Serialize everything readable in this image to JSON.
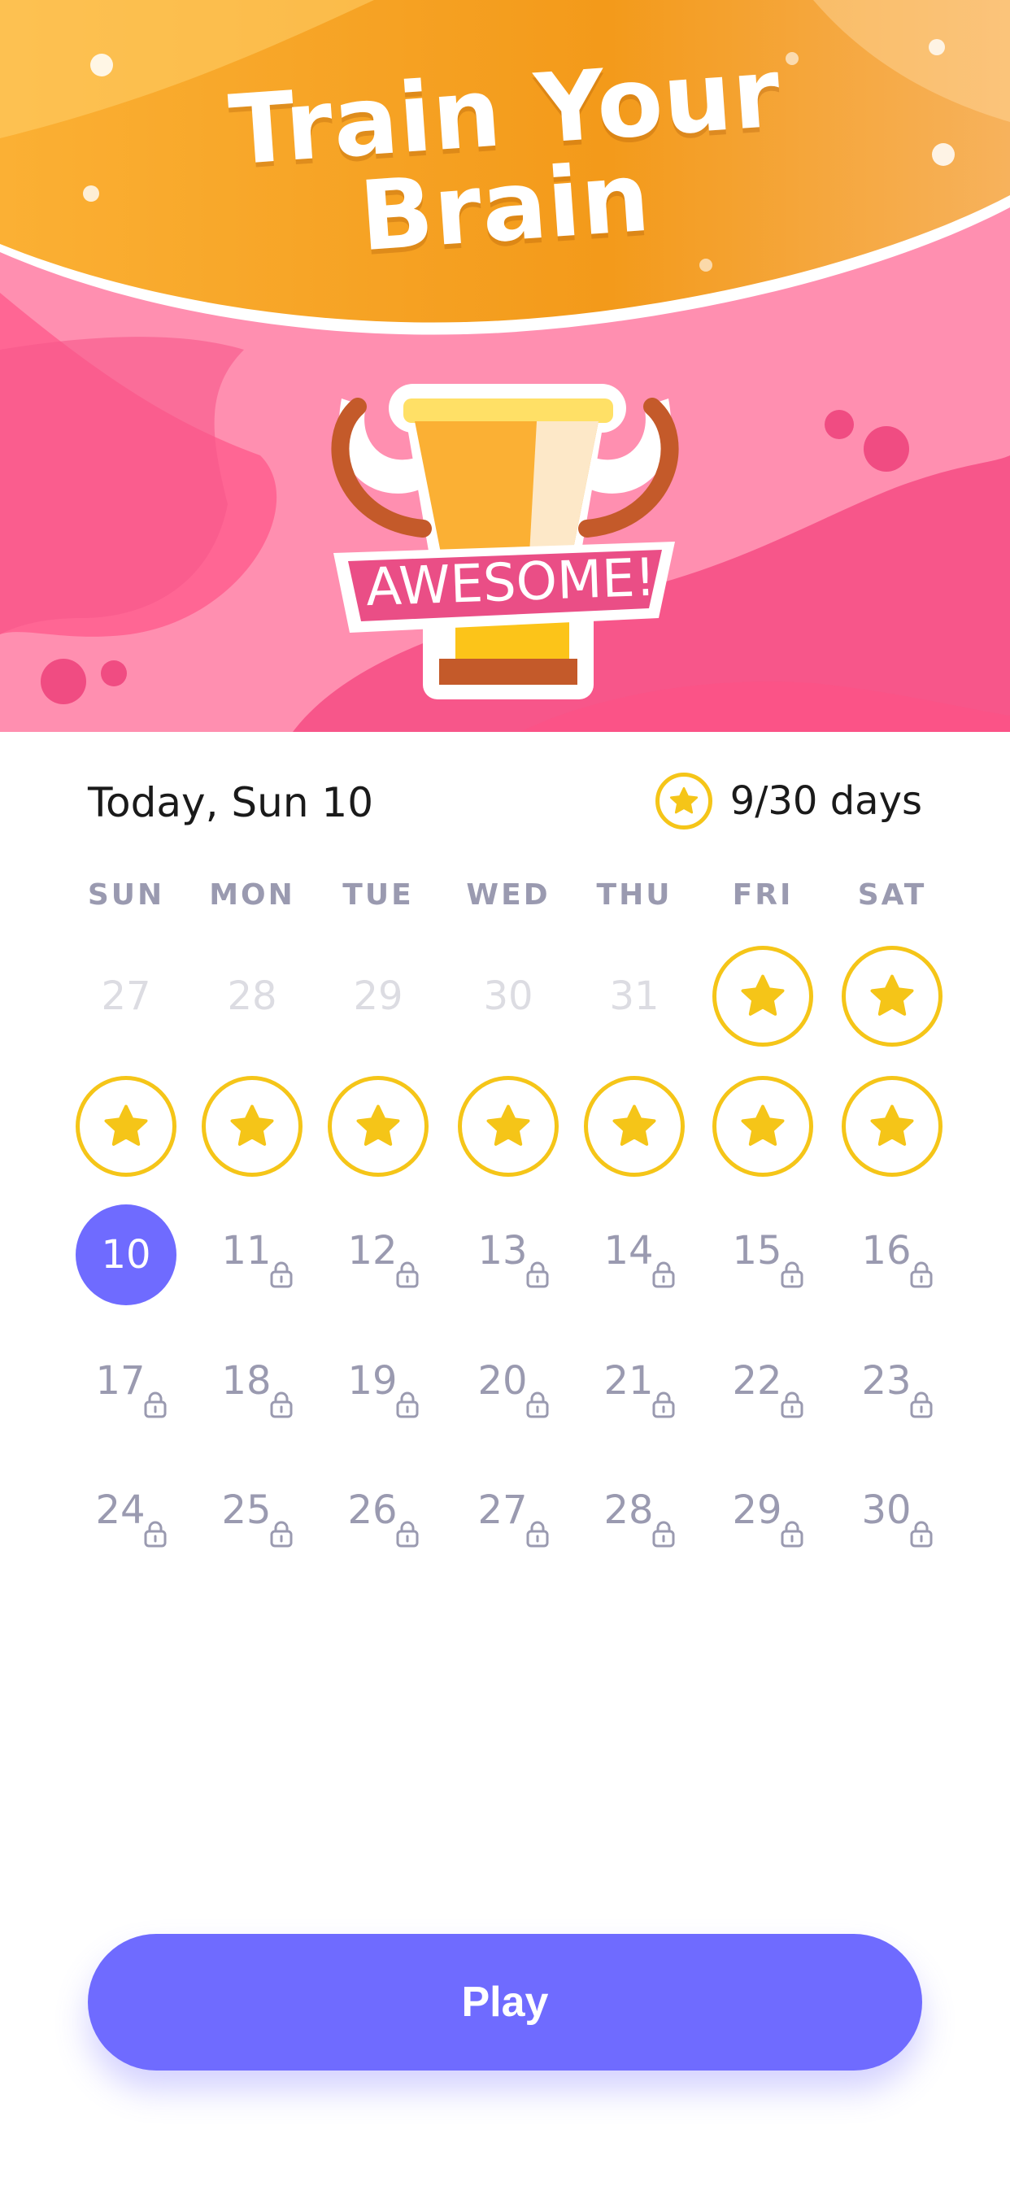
{
  "hero": {
    "title_line1": "Train Your",
    "title_line2": "Brain",
    "trophy_banner": "AWESOME!"
  },
  "status": {
    "date_label": "Today, Sun 10",
    "progress_label": "9/30 days",
    "progress_value": 0.3
  },
  "calendar": {
    "weekdays": [
      "SUN",
      "MON",
      "TUE",
      "WED",
      "THU",
      "FRI",
      "SAT"
    ],
    "weeks": [
      [
        {
          "label": "27",
          "state": "faded"
        },
        {
          "label": "28",
          "state": "faded"
        },
        {
          "label": "29",
          "state": "faded"
        },
        {
          "label": "30",
          "state": "faded"
        },
        {
          "label": "31",
          "state": "faded"
        },
        {
          "label": "",
          "state": "star"
        },
        {
          "label": "",
          "state": "star"
        }
      ],
      [
        {
          "label": "",
          "state": "star"
        },
        {
          "label": "",
          "state": "star"
        },
        {
          "label": "",
          "state": "star"
        },
        {
          "label": "",
          "state": "star"
        },
        {
          "label": "",
          "state": "star"
        },
        {
          "label": "",
          "state": "star"
        },
        {
          "label": "",
          "state": "star"
        }
      ],
      [
        {
          "label": "10",
          "state": "today"
        },
        {
          "label": "11",
          "state": "locked"
        },
        {
          "label": "12",
          "state": "locked"
        },
        {
          "label": "13",
          "state": "locked"
        },
        {
          "label": "14",
          "state": "locked"
        },
        {
          "label": "15",
          "state": "locked"
        },
        {
          "label": "16",
          "state": "locked"
        }
      ],
      [
        {
          "label": "17",
          "state": "locked"
        },
        {
          "label": "18",
          "state": "locked"
        },
        {
          "label": "19",
          "state": "locked"
        },
        {
          "label": "20",
          "state": "locked"
        },
        {
          "label": "21",
          "state": "locked"
        },
        {
          "label": "22",
          "state": "locked"
        },
        {
          "label": "23",
          "state": "locked"
        }
      ],
      [
        {
          "label": "24",
          "state": "locked"
        },
        {
          "label": "25",
          "state": "locked"
        },
        {
          "label": "26",
          "state": "locked"
        },
        {
          "label": "27",
          "state": "locked"
        },
        {
          "label": "28",
          "state": "locked"
        },
        {
          "label": "29",
          "state": "locked"
        },
        {
          "label": "30",
          "state": "locked"
        }
      ]
    ]
  },
  "play_button": {
    "label": "Play"
  },
  "colors": {
    "accent": "#6f6bff",
    "star": "#f5c518",
    "locked_text": "#9a9ab0",
    "faded_text": "#dcdce2",
    "hero_orange": "#f39c1a",
    "hero_pink": "#ff8fb0"
  },
  "icons": {
    "trophy": "trophy-icon",
    "star": "star-icon",
    "lock": "lock-icon"
  }
}
